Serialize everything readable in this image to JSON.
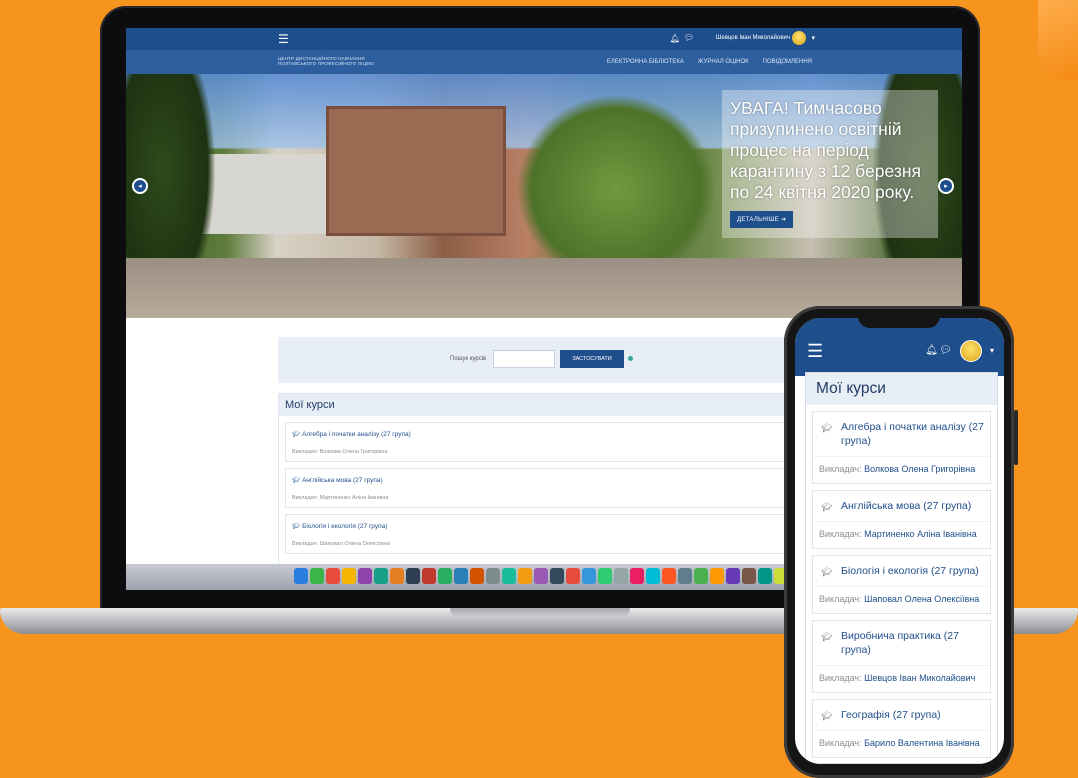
{
  "desktop": {
    "topbar": {
      "user_name": "Шевцов Іван Миколайович",
      "menu_icon": "hamburger-icon",
      "bell_icon": "bell-icon",
      "chat_icon": "chat-icon"
    },
    "brand": "ЦЕНТР ДИСТАНЦІЙНОГО НАВЧАННЯ ПОЛТАВСЬКОГО ПРОФЕСІЙНОГО ЛІЦЕЮ",
    "nav": [
      "ЕЛЕКТРОННА БІБЛІОТЕКА",
      "ЖУРНАЛ ОЦІНОК",
      "ПОВІДОМЛЕННЯ"
    ],
    "hero": {
      "caption": "УВАГА! Тимчасово призупинено освітній процес на період карантину з 12 березня по 24 квітня 2020 року.",
      "button": "ДЕТАЛЬНІШЕ ➔"
    },
    "search": {
      "label": "Пошук курсів",
      "button": "ЗАСТОСУВАТИ"
    },
    "my_courses_title": "Мої курси",
    "courses": [
      {
        "name": "Алгебра і початки аналізу (27 група)",
        "teacher_label": "Викладач:",
        "teacher": "Волкова Олена Григорівна"
      },
      {
        "name": "Англійська мова (27 група)",
        "teacher_label": "Викладач:",
        "teacher": "Мартиненко Аліна Іванівна"
      },
      {
        "name": "Біологія і екологія (27 група)",
        "teacher_label": "Викладач:",
        "teacher": "Шаповал Олена Олексіївна"
      }
    ]
  },
  "mobile": {
    "my_courses_title": "Мої курси",
    "courses": [
      {
        "name": "Алгебра і початки аналізу (27 група)",
        "teacher_label": "Викладач:",
        "teacher": "Волкова Олена Григорівна"
      },
      {
        "name": "Англійська мова (27 група)",
        "teacher_label": "Викладач:",
        "teacher": "Мартиненко Аліна Іванівна"
      },
      {
        "name": "Біологія і екологія (27 група)",
        "teacher_label": "Викладач:",
        "teacher": "Шаповал Олена Олексіївна"
      },
      {
        "name": "Виробнича практика (27 група)",
        "teacher_label": "Викладач:",
        "teacher": "Шевцов Іван Миколайович"
      },
      {
        "name": "Географія (27 група)",
        "teacher_label": "Викладач:",
        "teacher": "Барило Валентина Іванівна"
      }
    ]
  },
  "colors": {
    "background": "#f7941d",
    "brand_blue": "#1f4e8c",
    "panel": "#e8eef6"
  }
}
